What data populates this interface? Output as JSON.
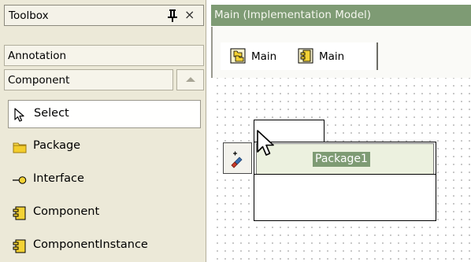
{
  "toolbox": {
    "title": "Toolbox",
    "pin_icon": "pin-icon",
    "close_label": "×",
    "categories": [
      "Annotation",
      "Component"
    ],
    "items": [
      {
        "label": "Select",
        "icon": "arrow-pointer-icon"
      },
      {
        "label": "Package",
        "icon": "folder-icon"
      },
      {
        "label": "Interface",
        "icon": "lollipop-interface-icon"
      },
      {
        "label": "Component",
        "icon": "component-icon"
      },
      {
        "label": "ComponentInstance",
        "icon": "component-instance-icon"
      }
    ]
  },
  "diagram": {
    "title": "Main (Implementation Model)",
    "tabs": [
      {
        "label": "Main",
        "icon": "package-diagram-icon"
      },
      {
        "label": "Main",
        "icon": "component-diagram-icon"
      }
    ],
    "package": {
      "name": "Package1"
    }
  },
  "colors": {
    "header_green": "#7e9b74",
    "toolbox_bg": "#ece9d8",
    "selection_text_bg": "#7e9b74",
    "name_box_bg": "#ecf1df"
  }
}
